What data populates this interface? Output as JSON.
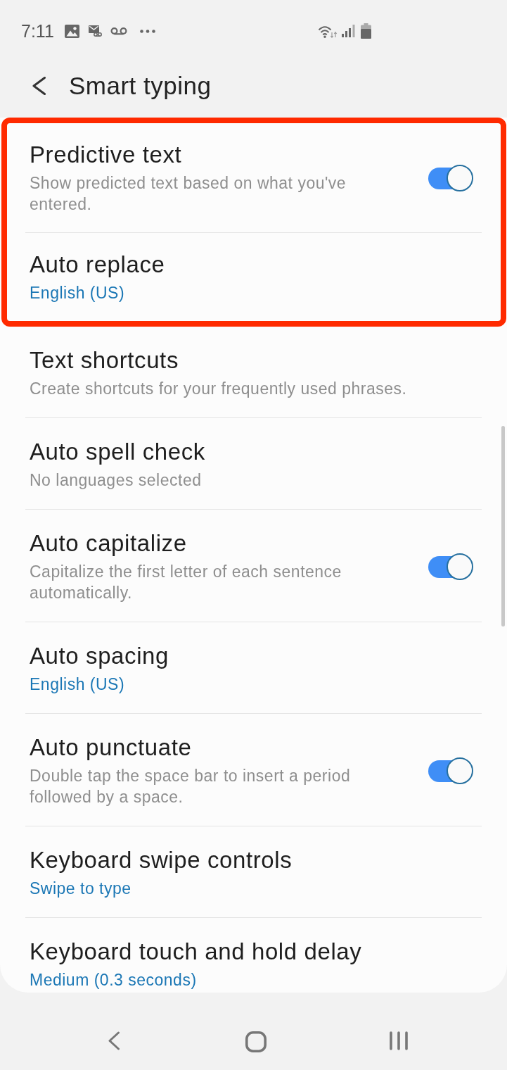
{
  "status_bar": {
    "time": "7:11"
  },
  "header": {
    "title": "Smart typing"
  },
  "items": [
    {
      "kind": "switch",
      "title": "Predictive text",
      "description": "Show predicted text based on what you've entered.",
      "on": true,
      "highlighted": true
    },
    {
      "kind": "link",
      "title": "Auto replace",
      "value": "English (US)",
      "highlighted": true
    },
    {
      "kind": "link",
      "title": "Text shortcuts",
      "description": "Create shortcuts for your frequently used phrases.",
      "highlighted": false
    },
    {
      "kind": "link",
      "title": "Auto spell check",
      "description": "No languages selected",
      "highlighted": false
    },
    {
      "kind": "switch",
      "title": "Auto capitalize",
      "description": "Capitalize the first letter of each sentence automatically.",
      "on": true,
      "highlighted": false
    },
    {
      "kind": "link",
      "title": "Auto spacing",
      "value": "English (US)",
      "highlighted": false
    },
    {
      "kind": "switch",
      "title": "Auto punctuate",
      "description": "Double tap the space bar to insert a period followed by a space.",
      "on": true,
      "highlighted": false
    },
    {
      "kind": "link",
      "title": "Keyboard swipe controls",
      "value": "Swipe to type",
      "highlighted": false
    },
    {
      "kind": "link",
      "title": "Keyboard touch and hold delay",
      "value": "Medium (0.3 seconds)",
      "highlighted": false
    }
  ]
}
